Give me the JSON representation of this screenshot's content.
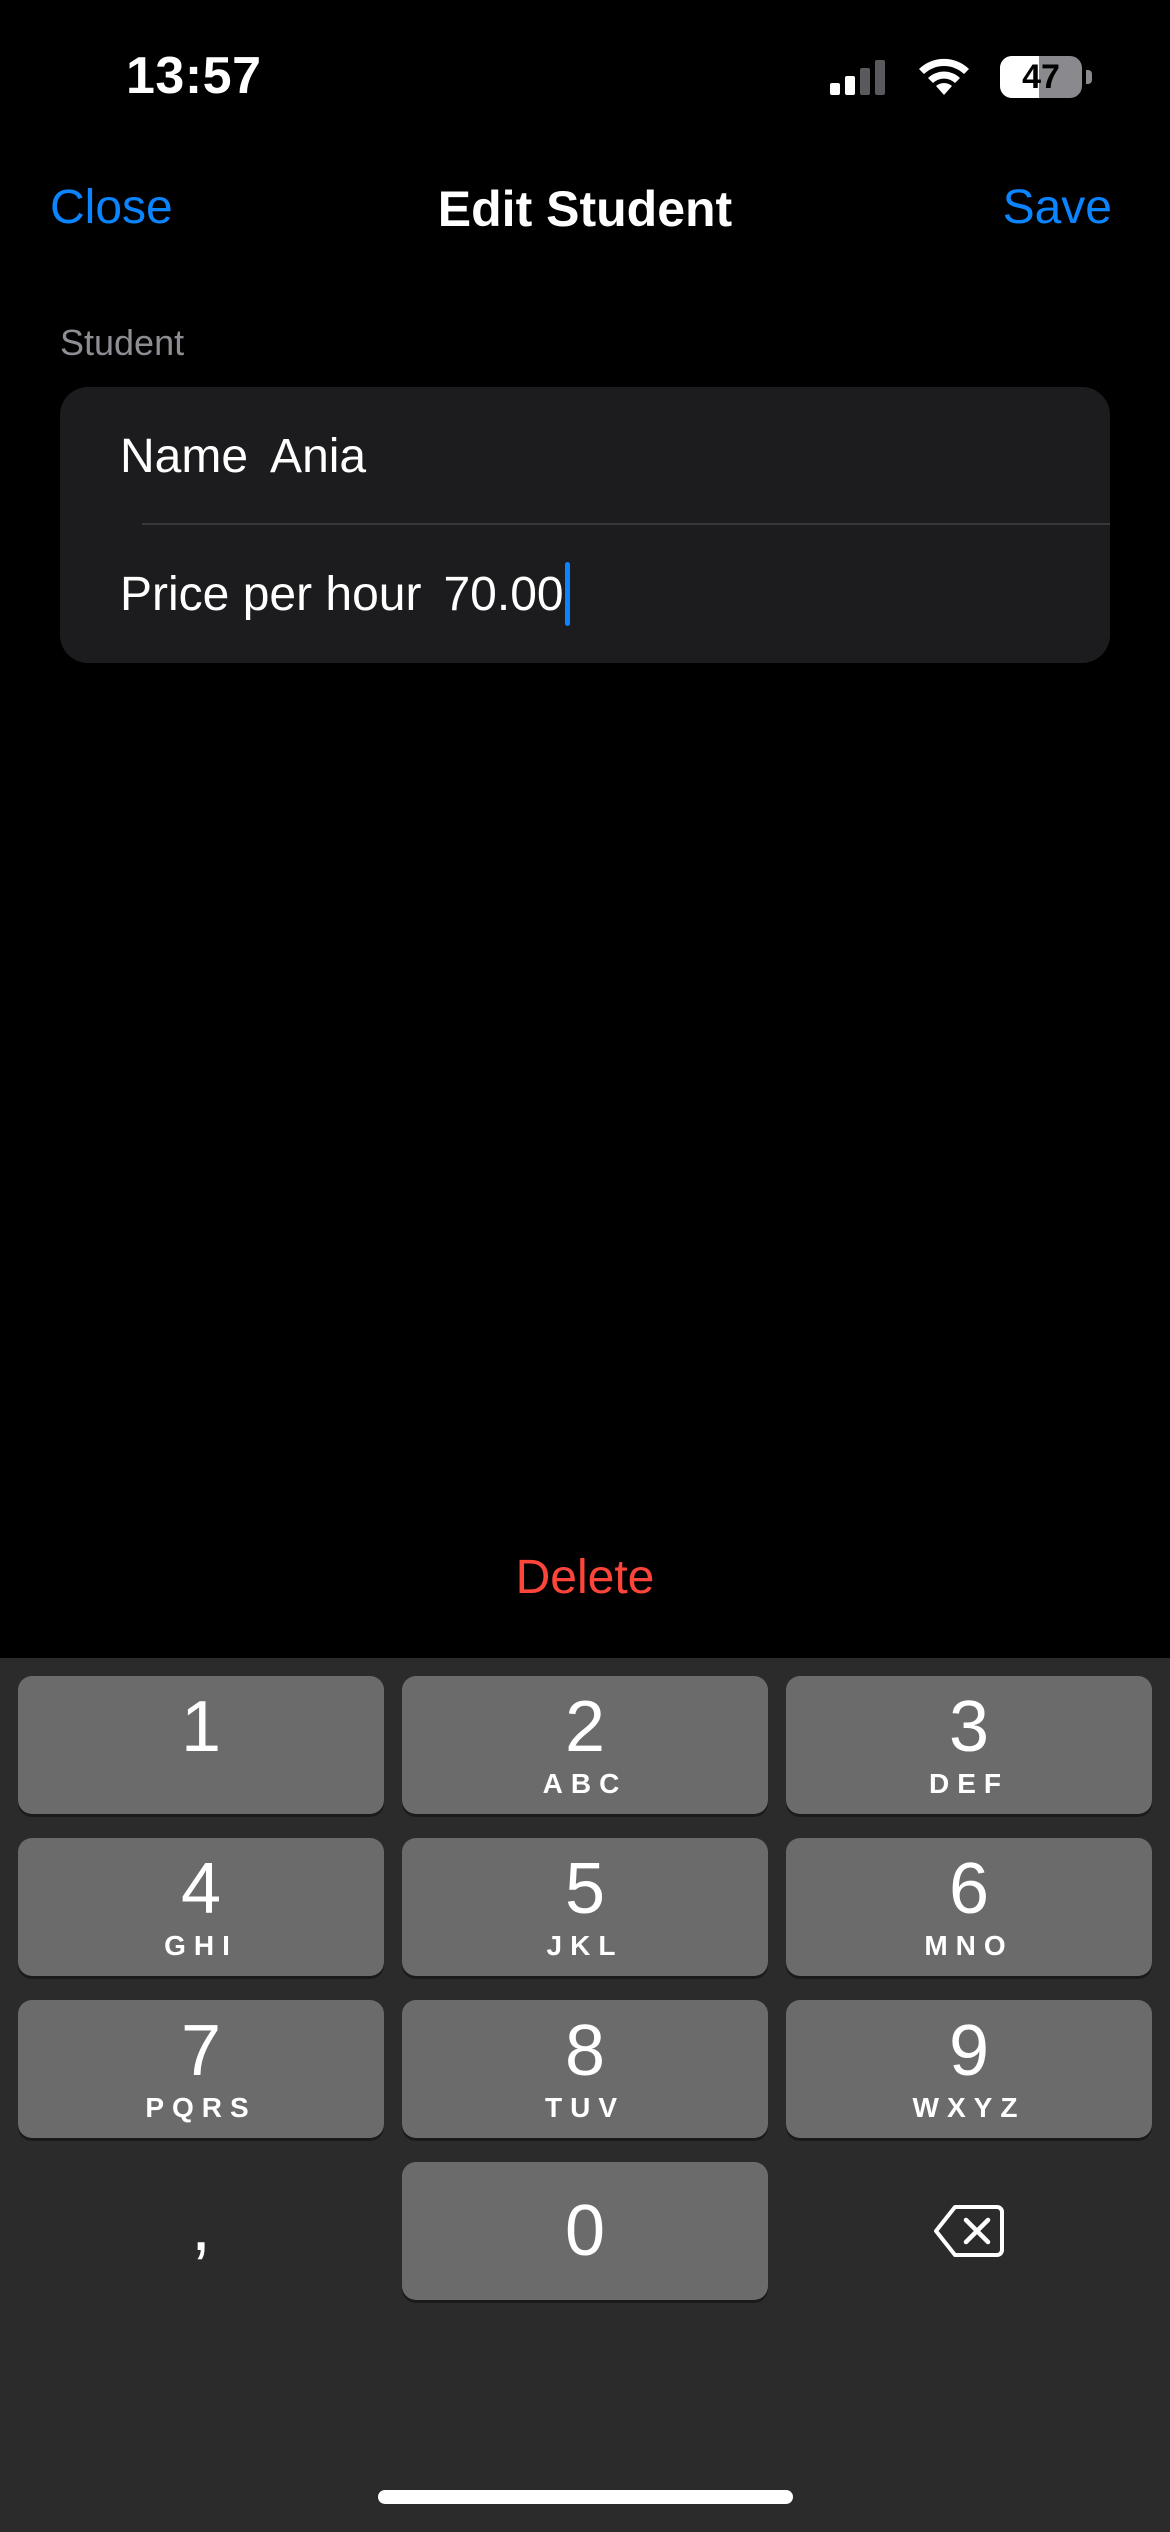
{
  "status_bar": {
    "time": "13:57",
    "battery_percent": "47",
    "battery_level": 0.47,
    "signal_bars": 2,
    "signal_bars_total": 4
  },
  "nav": {
    "close_label": "Close",
    "title": "Edit Student",
    "save_label": "Save",
    "accent_color": "#0a84ff"
  },
  "form": {
    "section_header": "Student",
    "name_label": "Name",
    "name_value": "Ania",
    "price_label": "Price per hour",
    "price_value": "70.00"
  },
  "delete_label": "Delete",
  "delete_color": "#ff453a",
  "keyboard": {
    "keys": [
      {
        "digit": "1",
        "letters": ""
      },
      {
        "digit": "2",
        "letters": "ABC"
      },
      {
        "digit": "3",
        "letters": "DEF"
      },
      {
        "digit": "4",
        "letters": "GHI"
      },
      {
        "digit": "5",
        "letters": "JKL"
      },
      {
        "digit": "6",
        "letters": "MNO"
      },
      {
        "digit": "7",
        "letters": "PQRS"
      },
      {
        "digit": "8",
        "letters": "TUV"
      },
      {
        "digit": "9",
        "letters": "WXYZ"
      },
      {
        "digit": "0",
        "letters": ""
      }
    ],
    "decimal_separator": ",",
    "delete_icon": "backspace-icon"
  }
}
